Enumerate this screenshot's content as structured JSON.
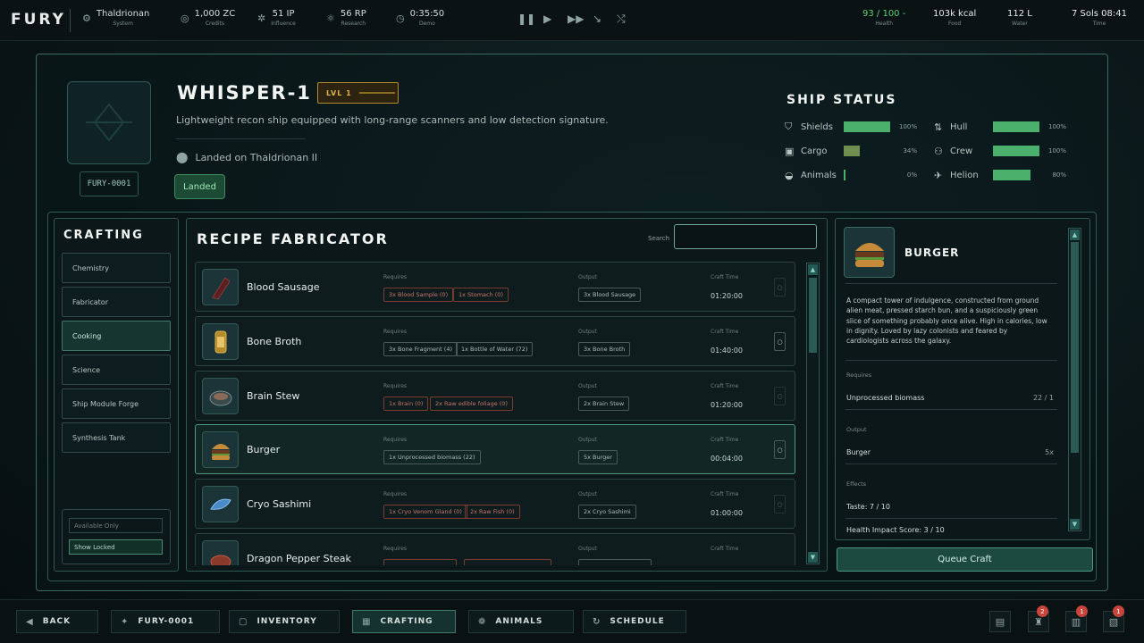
{
  "topbar": {
    "logo": "FURY",
    "stats": [
      {
        "icon": "system-icon",
        "value": "Thaldrionan",
        "label": "System"
      },
      {
        "icon": "credits-icon",
        "value": "1,000 ZC",
        "label": "Credits"
      },
      {
        "icon": "influence-icon",
        "value": "51 IP",
        "label": "Influence"
      },
      {
        "icon": "research-icon",
        "value": "56 RP",
        "label": "Research"
      },
      {
        "icon": "clock-icon",
        "value": "0:35:50",
        "label": "Demo"
      }
    ],
    "right_stats": [
      {
        "value": "93 / 100",
        "suffix": "-",
        "label": "Health",
        "color": "#5fd17a"
      },
      {
        "value": "103k kcal",
        "label": "Food"
      },
      {
        "value": "112 L",
        "label": "Water"
      },
      {
        "value": "7 Sols 08:41",
        "label": "Time"
      }
    ]
  },
  "ship": {
    "name": "WHISPER-1",
    "level": "LVL 1",
    "description": "Lightweight recon ship equipped with long-range scanners and low detection signature.",
    "location": "Landed on Thaldrionan II",
    "id": "FURY-0001",
    "status_button": "Landed"
  },
  "ship_status": {
    "title": "SHIP STATUS",
    "items": [
      {
        "name": "Shields",
        "icon": "shield-icon",
        "percent": 100,
        "pct_label": "100%"
      },
      {
        "name": "Hull",
        "icon": "hull-icon",
        "percent": 100,
        "pct_label": "100%"
      },
      {
        "name": "Cargo",
        "icon": "cargo-icon",
        "percent": 34,
        "pct_label": "34%"
      },
      {
        "name": "Crew",
        "icon": "crew-icon",
        "percent": 100,
        "pct_label": "100%"
      },
      {
        "name": "Animals",
        "icon": "animals-icon",
        "percent": 0,
        "pct_label": "0%"
      },
      {
        "name": "Helion",
        "icon": "helion-icon",
        "percent": 80,
        "pct_label": "80%"
      }
    ]
  },
  "crafting": {
    "title": "CRAFTING",
    "categories": [
      "Chemistry",
      "Fabricator",
      "Cooking",
      "Science",
      "Ship Module Forge",
      "Synthesis Tank"
    ],
    "active": "Cooking",
    "filters": [
      "Available Only",
      "Show Locked"
    ]
  },
  "fabricator": {
    "title": "RECIPE FABRICATOR",
    "search_label": "Search",
    "search_placeholder": "",
    "col_requires": "Requires",
    "col_output": "Output",
    "col_time": "Craft Time",
    "recipes": [
      {
        "name": "Blood Sausage",
        "requires": [
          "3x Blood Sample (0)",
          "1x Stomach (0)"
        ],
        "req_bad": [
          true,
          true
        ],
        "output": "3x Blood Sausage",
        "time": "01:20:00"
      },
      {
        "name": "Bone Broth",
        "requires": [
          "3x Bone Fragment (4)",
          "1x Bottle of Water (72)"
        ],
        "req_bad": [
          false,
          false
        ],
        "output": "3x Bone Broth",
        "time": "01:40:00"
      },
      {
        "name": "Brain Stew",
        "requires": [
          "1x Brain (0)",
          "2x Raw edible foliage (0)"
        ],
        "req_bad": [
          true,
          true
        ],
        "output": "2x Brain Stew",
        "time": "01:20:00"
      },
      {
        "name": "Burger",
        "requires": [
          "1x Unprocessed biomass (22)"
        ],
        "req_bad": [
          false
        ],
        "output": "5x Burger",
        "time": "00:04:00"
      },
      {
        "name": "Cryo Sashimi",
        "requires": [
          "1x Cryo Venom Gland (0)",
          "2x Raw Fish (0)"
        ],
        "req_bad": [
          true,
          true
        ],
        "output": "2x Cryo Sashimi",
        "time": "01:00:00"
      },
      {
        "name": "Dragon Pepper Steak",
        "requires": [
          "",
          ""
        ],
        "req_bad": [
          true,
          true
        ],
        "output": "",
        "time": ""
      }
    ]
  },
  "detail": {
    "title": "BURGER",
    "description": "A compact tower of indulgence, constructed from ground alien meat, pressed starch bun, and a suspiciously green slice of something probably once alive. High in calories, low in dignity. Loved by lazy colonists and feared by cardiologists across the galaxy.",
    "requires_label": "Requires",
    "requires_item": "Unprocessed biomass",
    "requires_count": "22 / 1",
    "output_label": "Output",
    "output_item": "Burger",
    "output_count": "5x",
    "effects_label": "Effects",
    "effect_1": "Taste: 7 / 10",
    "effect_2": "Health Impact Score: 3 / 10",
    "queue_button": "Queue Craft"
  },
  "bottom_nav": [
    {
      "label": "BACK",
      "icon": "back-arrow-icon"
    },
    {
      "label": "FURY-0001",
      "icon": "ship-icon"
    },
    {
      "label": "INVENTORY",
      "icon": "inventory-icon"
    },
    {
      "label": "CRAFTING",
      "icon": "crafting-icon"
    },
    {
      "label": "ANIMALS",
      "icon": "paw-icon"
    },
    {
      "label": "SCHEDULE",
      "icon": "schedule-icon"
    }
  ],
  "bottom_badges": [
    "2",
    "1",
    "1"
  ]
}
